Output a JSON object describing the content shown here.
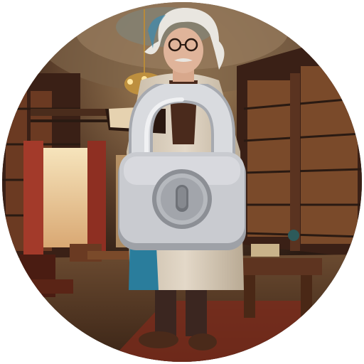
{
  "avatar": {
    "icon": "professor-in-library-illustration",
    "colors": {
      "wall_dark": "#2a1a12",
      "wood": "#6b3a22",
      "wood_dark": "#3a2016",
      "curtain": "#a33a2a",
      "window_glow": "#f3d9a6",
      "ceiling": "#8a6a4a",
      "floor": "#5a3a24",
      "carpet": "#7a2a1c",
      "coat": "#d9cdbd",
      "coat_shadow": "#b8a994",
      "scarf": "#2a7d9c",
      "hair": "#e9e6e0",
      "skin": "#e0b49a",
      "trousers": "#3b2620",
      "shoes": "#4a2a1a"
    }
  },
  "lock": {
    "icon": "padlock-icon",
    "state": "locked",
    "colors": {
      "body": "#c9cbd0",
      "body_light": "#e4e6ea",
      "body_shadow": "#9ea1a7",
      "shackle": "#d9dbdf",
      "shackle_shadow": "#a7aab0",
      "keyhole": "#8c8f95",
      "keyhole_inner": "#6f7278"
    }
  }
}
